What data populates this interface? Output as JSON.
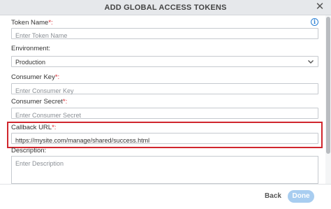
{
  "dialog": {
    "title": "ADD GLOBAL ACCESS TOKENS",
    "close_icon": "close-icon",
    "info_icon": "info-icon"
  },
  "form": {
    "token_name": {
      "label": "Token Name",
      "required_mark": "*:",
      "placeholder": "Enter Token Name",
      "value": ""
    },
    "environment": {
      "label": "Environment:",
      "value": "Production"
    },
    "consumer_key": {
      "label": "Consumer Key",
      "required_mark": "*:",
      "placeholder": "Enter Consumer Key",
      "value": ""
    },
    "consumer_secret": {
      "label": "Consumer Secret",
      "required_mark": "*:",
      "placeholder": "Enter Consumer Secret",
      "value": ""
    },
    "callback_url": {
      "label": "Callback URL",
      "required_mark": "*:",
      "value": "https://mysite.com/manage/shared/success.html"
    },
    "description": {
      "label": "Description:",
      "placeholder": "Enter Description",
      "value": ""
    }
  },
  "footer": {
    "back_label": "Back",
    "done_label": "Done"
  },
  "colors": {
    "accent": "#2a7fd4",
    "highlight": "#d0262d",
    "done_button": "#a8cdf0",
    "required": "#d9262c"
  }
}
